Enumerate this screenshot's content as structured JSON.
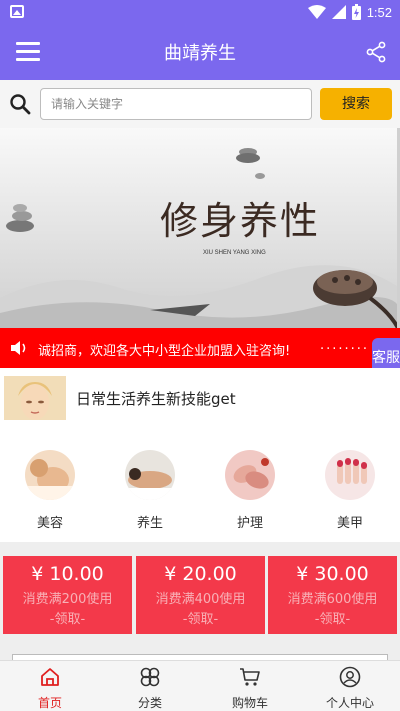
{
  "status_bar": {
    "time": "1:52"
  },
  "app_bar": {
    "title": "曲靖养生"
  },
  "search": {
    "placeholder": "请输入关键字",
    "button_label": "搜索"
  },
  "banner": {
    "title": "修身养性",
    "subtitle": "XIU SHEN YANG XING"
  },
  "notice": {
    "text": "诚招商，欢迎各大中小型企业加盟入驻咨询!",
    "trail": "........"
  },
  "float_button": {
    "label": "客服"
  },
  "headline": {
    "text": "日常生活养生新技能get"
  },
  "categories": [
    {
      "label": "美容",
      "icon": "beauty-face-icon"
    },
    {
      "label": "养生",
      "icon": "massage-back-icon"
    },
    {
      "label": "护理",
      "icon": "hand-care-icon"
    },
    {
      "label": "美甲",
      "icon": "nail-art-icon"
    }
  ],
  "coupons": [
    {
      "amount": "¥ 10.00",
      "condition": "消费满200使用",
      "action": "-领取-"
    },
    {
      "amount": "¥ 20.00",
      "condition": "消费满400使用",
      "action": "-领取-"
    },
    {
      "amount": "¥ 30.00",
      "condition": "消费满600使用",
      "action": "-领取-"
    }
  ],
  "bottom_nav": [
    {
      "label": "首页",
      "icon": "home-icon",
      "active": true
    },
    {
      "label": "分类",
      "icon": "category-icon",
      "active": false
    },
    {
      "label": "购物车",
      "icon": "cart-icon",
      "active": false
    },
    {
      "label": "个人中心",
      "icon": "user-icon",
      "active": false
    }
  ],
  "colors": {
    "primary": "#7b68ee",
    "search_button": "#f6b100",
    "notice": "#ff0000",
    "coupon": "#f3394a",
    "active_nav": "#e02020"
  }
}
